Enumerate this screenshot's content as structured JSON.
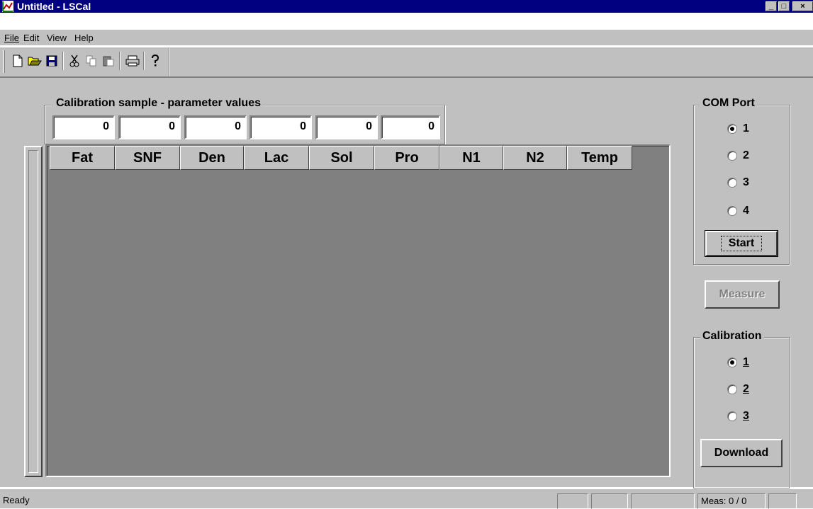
{
  "window": {
    "title": "Untitled - LSCal",
    "minimize": "_",
    "maximize": "□",
    "close": "×"
  },
  "menu": [
    {
      "label": "File"
    },
    {
      "label": "Edit"
    },
    {
      "label": "View"
    },
    {
      "label": "Help"
    }
  ],
  "toolbar": {
    "buttons": [
      "new-icon",
      "open-icon",
      "save-icon",
      "cut-icon",
      "copy-icon",
      "paste-icon",
      "print-icon",
      "help-icon"
    ]
  },
  "calibration_sample": {
    "label": "Calibration sample - parameter values",
    "values": [
      "0",
      "0",
      "0",
      "0",
      "0",
      "0"
    ]
  },
  "table": {
    "columns": [
      "Fat",
      "SNF",
      "Den",
      "Lac",
      "Sol",
      "Pro",
      "N1",
      "N2",
      "Temp"
    ],
    "rows": []
  },
  "com_port": {
    "label": "COM Port",
    "options": [
      "1",
      "2",
      "3",
      "4"
    ],
    "selected": "1",
    "start_label": "Start"
  },
  "measure_label": "Measure",
  "calibration": {
    "label": "Calibration",
    "options": [
      "1",
      "2",
      "3"
    ],
    "selected": "1",
    "download_label": "Download"
  },
  "status": {
    "text": "Ready",
    "meas": "Meas: 0 / 0"
  },
  "colors": {
    "titlebar": "#000080",
    "face": "#c0c0c0",
    "grid_bg": "#808080"
  }
}
